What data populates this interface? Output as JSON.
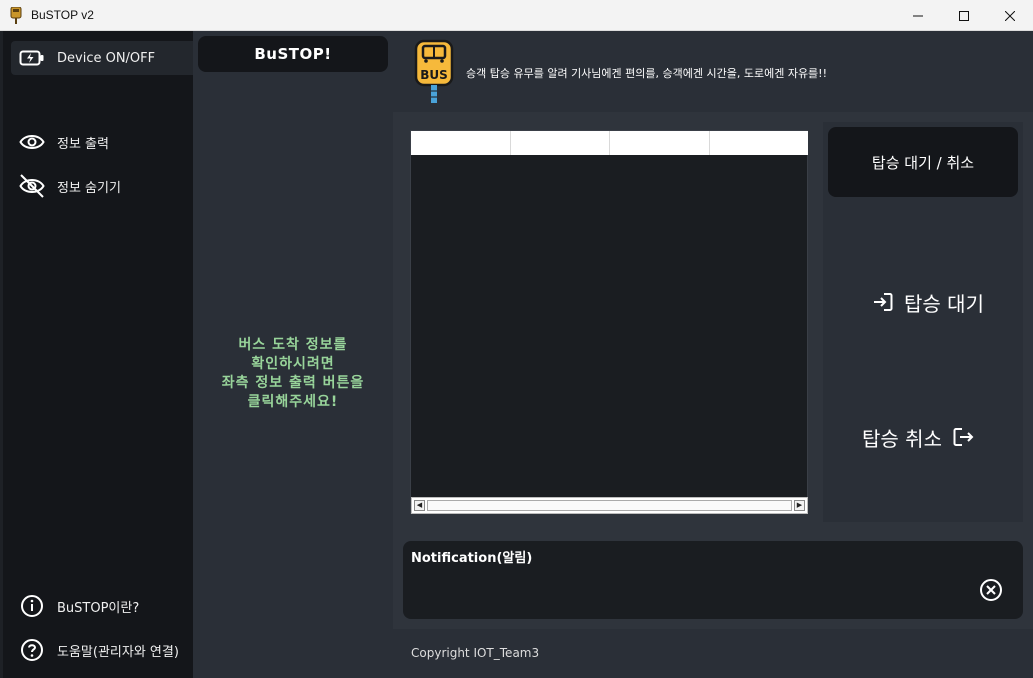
{
  "window": {
    "title": "BuSTOP v2"
  },
  "sidebar": {
    "items": [
      {
        "label": "Device ON/OFF",
        "icon": "battery-charging-icon"
      },
      {
        "label": "정보 출력",
        "icon": "eye-icon"
      },
      {
        "label": "정보 숨기기",
        "icon": "eye-off-icon"
      }
    ],
    "bottom": [
      {
        "label": "BuSTOP이란?",
        "icon": "info-icon"
      },
      {
        "label": "도움말(관리자와 연결)",
        "icon": "help-icon"
      }
    ]
  },
  "middle": {
    "logo_text": "BuSTOP!",
    "message": "버스 도착 정보를\n확인하시려면\n좌측 정보 출력 버튼을\n클릭해주세요!"
  },
  "header": {
    "slogan": "승객 탑승 유무를 알려 기사님에겐 편의를, 승객에겐 시간을, 도로에겐 자유를!!",
    "logo_text": "BUS"
  },
  "table": {
    "columns": [
      "",
      "",
      "",
      ""
    ]
  },
  "actions": {
    "wait_cancel": "탑승 대기 / 취소",
    "board_wait": "탑승 대기",
    "board_cancel": "탑승 취소"
  },
  "notification": {
    "title": "Notification(알림)",
    "body": ""
  },
  "footer": {
    "copyright": "Copyright IOT_Team3"
  },
  "colors": {
    "accent_green": "#98d49a",
    "bus_yellow": "#f6b93b"
  }
}
